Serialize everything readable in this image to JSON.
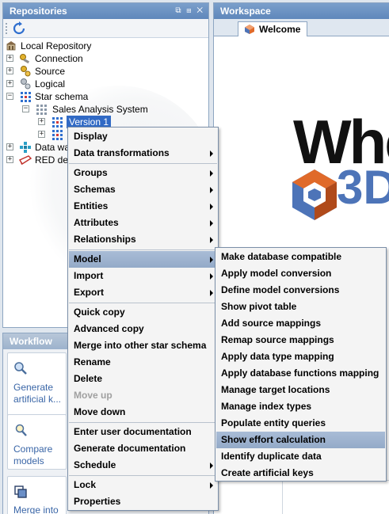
{
  "repositories": {
    "title": "Repositories",
    "header_icons": "⧉ ⊞ ✕",
    "tree": [
      {
        "label": "Local Repository",
        "icon": "repository-icon"
      },
      {
        "label": "Connection",
        "icon": "connection-icon"
      },
      {
        "label": "Source",
        "icon": "source-icon"
      },
      {
        "label": "Logical",
        "icon": "logical-icon"
      },
      {
        "label": "Star schema",
        "icon": "star-schema-icon"
      },
      {
        "label": "Sales Analysis System",
        "icon": "folder-grid-icon"
      },
      {
        "label": "Version 1",
        "icon": "version-icon"
      },
      {
        "label": "",
        "icon": "version-icon"
      },
      {
        "label": "Data wa",
        "icon": "data-warehouse-icon"
      },
      {
        "label": "RED de",
        "icon": "red-icon"
      }
    ]
  },
  "workflow": {
    "title": "Workflow",
    "buttons": [
      {
        "label": "Generate artificial k...",
        "icon": "magnifier-icon"
      },
      {
        "label": "Compare models",
        "icon": "compare-icon"
      },
      {
        "label": "Merge into",
        "icon": "merge-icon"
      }
    ]
  },
  "workspace": {
    "title": "Workspace",
    "tab": "Welcome",
    "banner_text": "Whe",
    "logo_text": "3D",
    "colors": {
      "brand_blue": "#4d74b8",
      "logo_orange": "#e06a2a"
    }
  },
  "context_menu": {
    "items": [
      {
        "label": "Display",
        "submenu": false
      },
      {
        "label": "Data transformations",
        "submenu": true
      },
      {
        "label": "Groups",
        "submenu": true
      },
      {
        "label": "Schemas",
        "submenu": true
      },
      {
        "label": "Entities",
        "submenu": true
      },
      {
        "label": "Attributes",
        "submenu": true
      },
      {
        "label": "Relationships",
        "submenu": true
      },
      {
        "label": "Model",
        "submenu": true,
        "highlighted": true
      },
      {
        "label": "Import",
        "submenu": true
      },
      {
        "label": "Export",
        "submenu": true
      },
      {
        "label": "Quick copy",
        "submenu": false
      },
      {
        "label": "Advanced copy",
        "submenu": false
      },
      {
        "label": "Merge into other star schema",
        "submenu": false
      },
      {
        "label": "Rename",
        "submenu": false
      },
      {
        "label": "Delete",
        "submenu": false
      },
      {
        "label": "Move up",
        "submenu": false,
        "disabled": true
      },
      {
        "label": "Move down",
        "submenu": false
      },
      {
        "label": "Enter user documentation",
        "submenu": false
      },
      {
        "label": "Generate documentation",
        "submenu": false
      },
      {
        "label": "Schedule",
        "submenu": true
      },
      {
        "label": "Lock",
        "submenu": true
      },
      {
        "label": "Properties",
        "submenu": false
      }
    ]
  },
  "model_submenu": {
    "items": [
      "Make database compatible",
      "Apply model conversion",
      "Define model conversions",
      "Show pivot table",
      "Add source mappings",
      "Remap source mappings",
      "Apply data type mapping",
      "Apply database functions mapping",
      "Manage target locations",
      "Manage index types",
      "Populate entity queries",
      "Show effort calculation",
      "Identify duplicate data",
      "Create artificial keys"
    ],
    "highlighted": "Show effort calculation"
  }
}
